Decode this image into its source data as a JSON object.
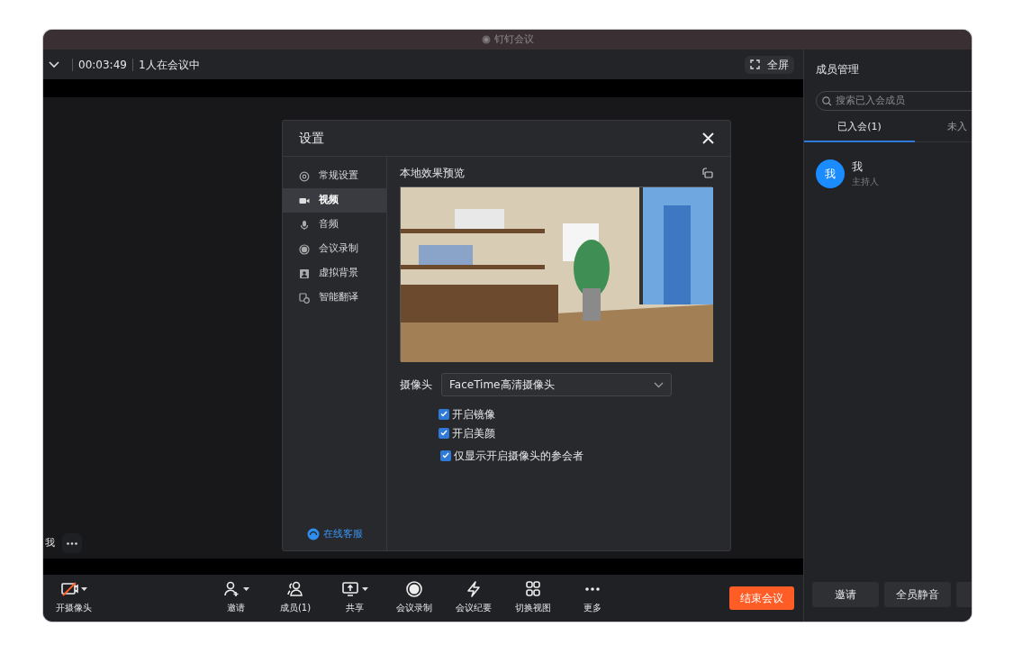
{
  "window": {
    "title": "钉钉会议"
  },
  "top_bar": {
    "timer": "00:03:49",
    "status": "1人在会议中",
    "fullscreen": "全屏"
  },
  "video": {
    "participant_name": "我"
  },
  "settings_dialog": {
    "title": "设置",
    "nav": [
      {
        "label": "常规设置",
        "kind": "general",
        "selected": false
      },
      {
        "label": "视频",
        "kind": "video",
        "selected": true
      },
      {
        "label": "音频",
        "kind": "audio",
        "selected": false
      },
      {
        "label": "会议录制",
        "kind": "record",
        "selected": false
      },
      {
        "label": "虚拟背景",
        "kind": "background",
        "selected": false
      },
      {
        "label": "智能翻译",
        "kind": "translate",
        "selected": false
      }
    ],
    "support": "在线客服",
    "preview_label": "本地效果预览",
    "camera_label": "摄像头",
    "camera_value": "FaceTime高清摄像头",
    "checkboxes": [
      {
        "label": "开启镜像",
        "checked": true
      },
      {
        "label": "开启美颜",
        "checked": true
      },
      {
        "label": "仅显示开启摄像头的参会者",
        "checked": true
      }
    ]
  },
  "toolbar": {
    "items": [
      {
        "label": "开摄像头",
        "kind": "camera",
        "dropdown": true
      },
      {
        "label": "邀请",
        "kind": "invite",
        "dropdown": true
      },
      {
        "label": "成员(1)",
        "kind": "members",
        "dropdown": false
      },
      {
        "label": "共享",
        "kind": "share",
        "dropdown": true
      },
      {
        "label": "会议录制",
        "kind": "record",
        "dropdown": false
      },
      {
        "label": "会议纪要",
        "kind": "minutes",
        "dropdown": false
      },
      {
        "label": "切换视图",
        "kind": "layout",
        "dropdown": false
      },
      {
        "label": "更多",
        "kind": "more",
        "dropdown": false
      }
    ],
    "end_button": "结束会议"
  },
  "members_panel": {
    "title": "成员管理",
    "search": {
      "placeholder": "搜索已入会成员"
    },
    "tabs": [
      {
        "label": "已入会(1)",
        "selected": true
      },
      {
        "label": "未入",
        "selected": false
      }
    ],
    "members": [
      {
        "avatar": "我",
        "name": "我",
        "role": "主持人"
      }
    ],
    "buttons": [
      "邀请",
      "全员静音"
    ]
  }
}
